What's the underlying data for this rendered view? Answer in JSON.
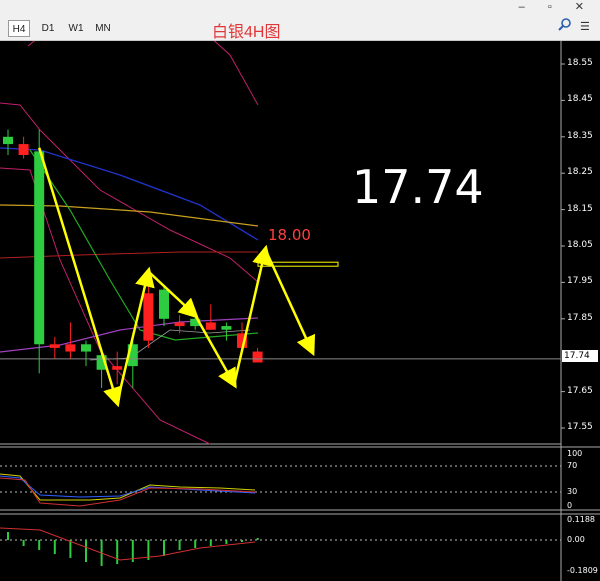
{
  "toolbar": {
    "timeframes": [
      "H4",
      "D1",
      "W1",
      "MN"
    ],
    "active_timeframe": "H4",
    "title": "白银4H图",
    "window_controls": "– ▫ ✕"
  },
  "price_axis": {
    "labels": [
      "18.55",
      "18.45",
      "18.35",
      "18.25",
      "18.15",
      "18.05",
      "17.95",
      "17.85",
      "17.74",
      "17.65",
      "17.55"
    ],
    "current": "17.74"
  },
  "overlay": {
    "big_price": "17.74",
    "target": "18.00"
  },
  "oscillator1": {
    "levels": [
      "100",
      "70",
      "30",
      "0"
    ]
  },
  "oscillator2": {
    "levels": [
      "0.1188",
      "0.00",
      "-0.1809"
    ]
  },
  "colors": {
    "background": "#000000",
    "bull": "#2ecc40",
    "bear": "#ff2020",
    "forecast": "#ffff00",
    "ma_blue": "#2233cc",
    "ma_green": "#22aa22",
    "ma_yellow": "#c8a020",
    "band_magenta": "#c0206a",
    "ma_violet": "#a040c0"
  },
  "chart_data": {
    "type": "candlestick",
    "symbol_title": "白银4H图",
    "timeframe": "H4",
    "ylim": [
      17.5,
      18.6
    ],
    "current_price": 17.74,
    "target_price": 18.0,
    "candles": [
      {
        "o": 18.33,
        "h": 18.37,
        "l": 18.3,
        "c": 18.35
      },
      {
        "o": 18.33,
        "h": 18.35,
        "l": 18.29,
        "c": 18.3
      },
      {
        "o": 17.78,
        "h": 18.37,
        "l": 17.7,
        "c": 18.31
      },
      {
        "o": 17.78,
        "h": 17.8,
        "l": 17.74,
        "c": 17.77
      },
      {
        "o": 17.78,
        "h": 17.84,
        "l": 17.74,
        "c": 17.76
      },
      {
        "o": 17.76,
        "h": 17.79,
        "l": 17.72,
        "c": 17.78
      },
      {
        "o": 17.71,
        "h": 17.77,
        "l": 17.66,
        "c": 17.75
      },
      {
        "o": 17.72,
        "h": 17.76,
        "l": 17.67,
        "c": 17.71
      },
      {
        "o": 17.72,
        "h": 17.79,
        "l": 17.66,
        "c": 17.78
      },
      {
        "o": 17.92,
        "h": 17.96,
        "l": 17.77,
        "c": 17.79
      },
      {
        "o": 17.85,
        "h": 17.94,
        "l": 17.83,
        "c": 17.93
      },
      {
        "o": 17.84,
        "h": 17.86,
        "l": 17.81,
        "c": 17.83
      },
      {
        "o": 17.83,
        "h": 17.87,
        "l": 17.82,
        "c": 17.85
      },
      {
        "o": 17.84,
        "h": 17.89,
        "l": 17.82,
        "c": 17.82
      },
      {
        "o": 17.82,
        "h": 17.84,
        "l": 17.79,
        "c": 17.83
      },
      {
        "o": 17.81,
        "h": 17.84,
        "l": 17.76,
        "c": 17.77
      },
      {
        "o": 17.76,
        "h": 17.77,
        "l": 17.73,
        "c": 17.73
      }
    ],
    "forecast_path": [
      {
        "i": 2,
        "p": 18.32
      },
      {
        "i": 7,
        "p": 17.62
      },
      {
        "i": 9,
        "p": 17.98
      },
      {
        "i": 12,
        "p": 17.86
      },
      {
        "i": 14.5,
        "p": 17.67
      },
      {
        "i": 16.5,
        "p": 18.04
      },
      {
        "i": 19.5,
        "p": 17.76
      }
    ]
  }
}
